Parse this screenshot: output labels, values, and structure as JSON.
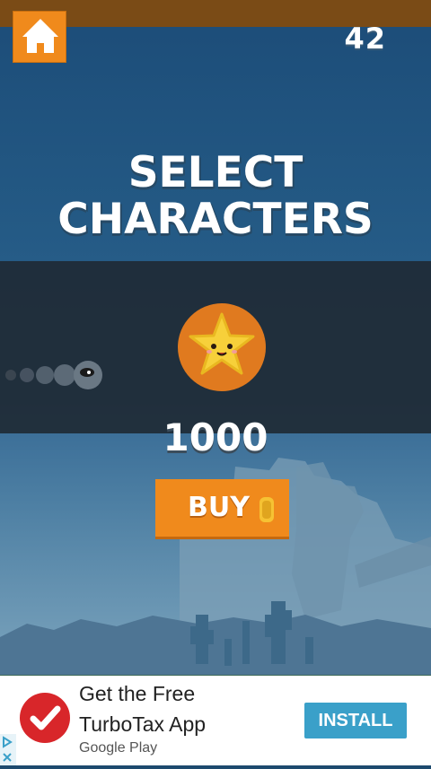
{
  "game": {
    "score": "42",
    "title_line1": "SELECT",
    "title_line2": "CHARACTERS",
    "character": {
      "name_icon": "star-character-icon",
      "price": "1000"
    },
    "buy_label": "BUY",
    "colors": {
      "accent": "#f08a1c",
      "top_bar": "#7a4b16",
      "circle": "#e07a1f"
    }
  },
  "ad": {
    "line1": "Get the Free",
    "line2": "TurboTax App",
    "store": "Google Play",
    "install_label": "INSTALL",
    "install_color": "#3aa0c9"
  }
}
